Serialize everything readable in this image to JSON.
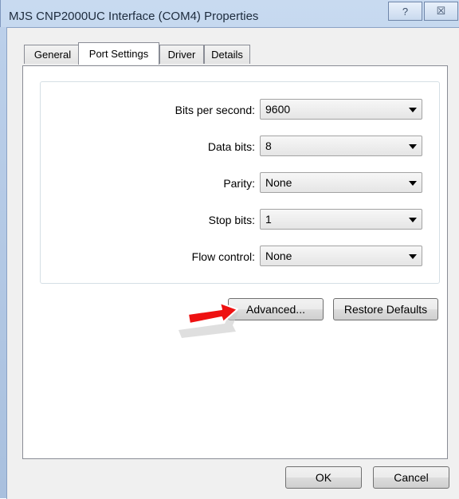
{
  "window": {
    "title": "MJS CNP2000UC Interface (COM4) Properties",
    "help_glyph": "?",
    "close_glyph": "☒"
  },
  "tabs": [
    {
      "label": "General",
      "active": false
    },
    {
      "label": "Port Settings",
      "active": true
    },
    {
      "label": "Driver",
      "active": false
    },
    {
      "label": "Details",
      "active": false
    }
  ],
  "settings": {
    "bits_per_second": {
      "label": "Bits per second:",
      "value": "9600"
    },
    "data_bits": {
      "label": "Data bits:",
      "value": "8"
    },
    "parity": {
      "label": "Parity:",
      "value": "None"
    },
    "stop_bits": {
      "label": "Stop bits:",
      "value": "1"
    },
    "flow_control": {
      "label": "Flow control:",
      "value": "None"
    }
  },
  "buttons": {
    "advanced": "Advanced...",
    "restore_defaults": "Restore Defaults",
    "ok": "OK",
    "cancel": "Cancel"
  },
  "colors": {
    "annotation_arrow": "#ee1111"
  }
}
